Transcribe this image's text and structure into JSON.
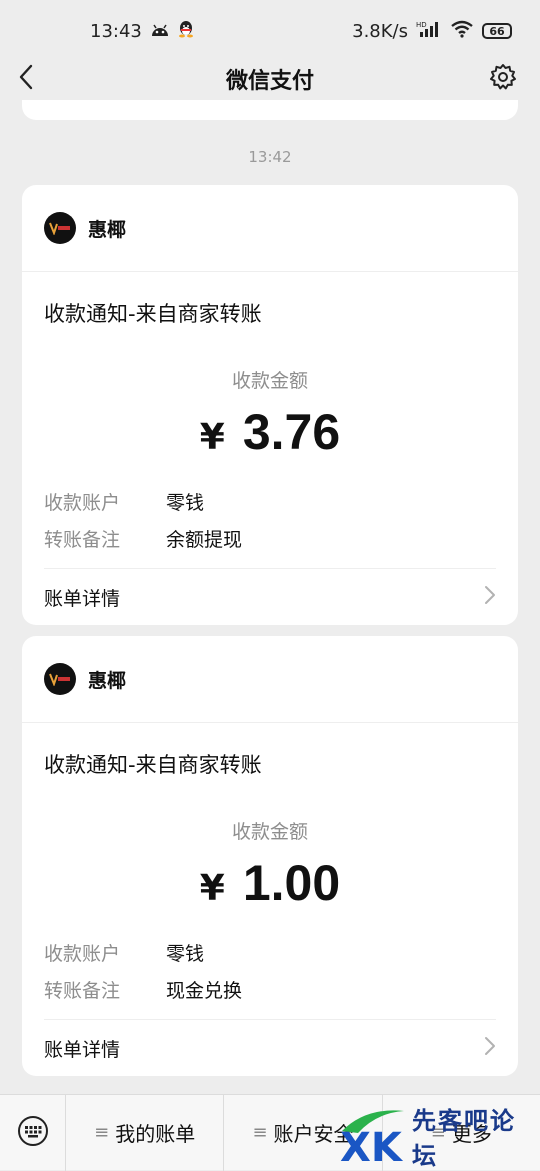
{
  "status_bar": {
    "time": "13:43",
    "network_speed": "3.8K/s",
    "battery": "66",
    "icons": [
      "android-icon",
      "qq-icon",
      "hd-signal-icon",
      "wifi-icon",
      "battery-icon"
    ]
  },
  "nav": {
    "title": "微信支付",
    "back_icon": "chevron-left-icon",
    "settings_icon": "gear-icon"
  },
  "timestamp": "13:42",
  "cards": [
    {
      "merchant": "惠椰",
      "title": "收款通知-来自商家转账",
      "amount_label": "收款金额",
      "currency": "¥",
      "amount": "3.76",
      "details": [
        {
          "label": "收款账户",
          "value": "零钱"
        },
        {
          "label": "转账备注",
          "value": "余额提现"
        }
      ],
      "footer": "账单详情"
    },
    {
      "merchant": "惠椰",
      "title": "收款通知-来自商家转账",
      "amount_label": "收款金额",
      "currency": "¥",
      "amount": "1.00",
      "details": [
        {
          "label": "收款账户",
          "value": "零钱"
        },
        {
          "label": "转账备注",
          "value": "现金兑换"
        }
      ],
      "footer": "账单详情"
    }
  ],
  "bottom_menu": {
    "keyboard_icon": "keyboard-icon",
    "items": [
      "我的账单",
      "账户安全",
      "更多"
    ]
  },
  "watermark": {
    "logo": "XK",
    "text": "先客吧论坛"
  }
}
